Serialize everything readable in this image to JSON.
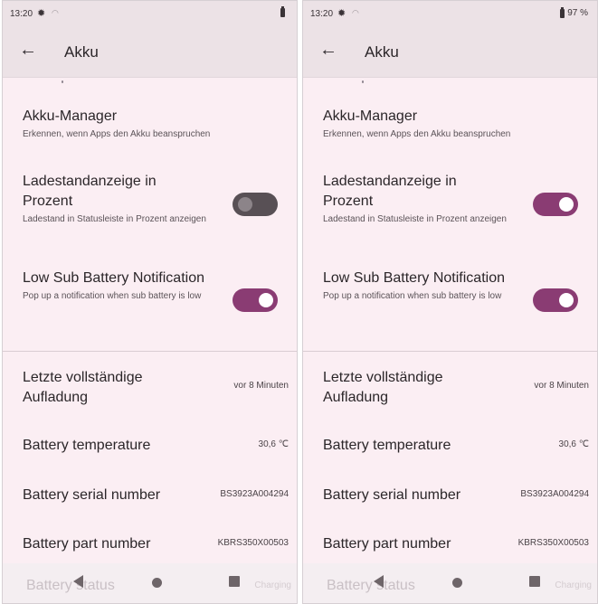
{
  "screens": [
    {
      "status": {
        "time": "13:20",
        "battery_percent": ""
      },
      "appbar": {
        "title": "Akku"
      },
      "akku_manager": {
        "label": "Akku-Manager",
        "desc": "Erkennen, wenn Apps den Akku beanspruchen"
      },
      "percent_toggle": {
        "label": "Ladestandanzeige in Prozent",
        "desc": "Ladestand in Statusleiste in Prozent anzeigen",
        "state": "off"
      },
      "low_sub": {
        "label": "Low Sub Battery Notification",
        "desc": "Pop up a notification when sub battery is low",
        "state": "on"
      },
      "info": [
        {
          "label": "Letzte vollständige Aufladung",
          "value": "vor 8 Minuten"
        },
        {
          "label": "Battery temperature",
          "value": "30,6 ℃"
        },
        {
          "label": "Battery serial number",
          "value": "BS3923A004294"
        },
        {
          "label": "Battery part number",
          "value": "KBRS350X00503"
        }
      ],
      "ghost": {
        "label": "Battery status",
        "value": "Charging"
      }
    },
    {
      "status": {
        "time": "13:20",
        "battery_percent": "97 %"
      },
      "appbar": {
        "title": "Akku"
      },
      "akku_manager": {
        "label": "Akku-Manager",
        "desc": "Erkennen, wenn Apps den Akku beanspruchen"
      },
      "percent_toggle": {
        "label": "Ladestandanzeige in Prozent",
        "desc": "Ladestand in Statusleiste in Prozent anzeigen",
        "state": "on"
      },
      "low_sub": {
        "label": "Low Sub Battery Notification",
        "desc": "Pop up a notification when sub battery is low",
        "state": "on"
      },
      "info": [
        {
          "label": "Letzte vollständige Aufladung",
          "value": "vor 8 Minuten"
        },
        {
          "label": "Battery temperature",
          "value": "30,6 ℃"
        },
        {
          "label": "Battery serial number",
          "value": "BS3923A004294"
        },
        {
          "label": "Battery part number",
          "value": "KBRS350X00503"
        }
      ],
      "ghost": {
        "label": "Battery status",
        "value": "Charging"
      }
    }
  ],
  "icons": {
    "settings": "gear-icon",
    "wifi": "wifi-icon",
    "battery": "battery-icon",
    "back": "arrow-left-icon",
    "nav_back": "nav-back-icon",
    "nav_home": "nav-home-icon",
    "nav_recents": "nav-recents-icon"
  },
  "colors": {
    "toggle_on": "#8a3c73",
    "toggle_off": "#585055",
    "background": "#fbeef3",
    "appbar": "#ece2e6"
  }
}
